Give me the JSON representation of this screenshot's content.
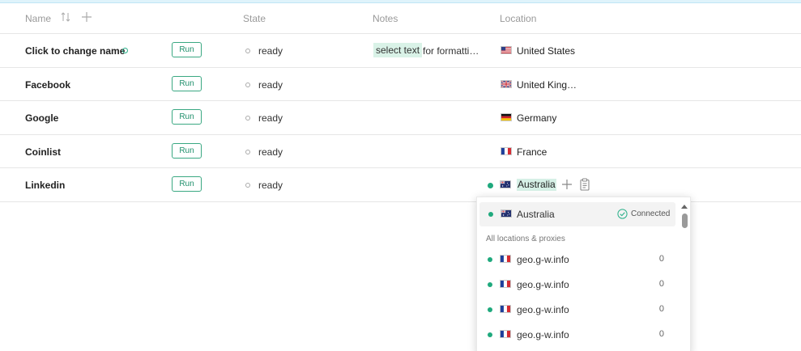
{
  "columns": {
    "name": "Name",
    "state": "State",
    "notes": "Notes",
    "location": "Location"
  },
  "run_label": "Run",
  "rows": [
    {
      "name": "Click to change name",
      "state": "ready",
      "note_highlight": "select text",
      "note_rest": "for formatti…",
      "location": "United States",
      "flag": "us"
    },
    {
      "name": "Facebook",
      "state": "ready",
      "note_highlight": "",
      "note_rest": "",
      "location": "United King…",
      "flag": "uk"
    },
    {
      "name": "Google",
      "state": "ready",
      "note_highlight": "",
      "note_rest": "",
      "location": "Germany",
      "flag": "de"
    },
    {
      "name": "Coinlist",
      "state": "ready",
      "note_highlight": "",
      "note_rest": "",
      "location": "France",
      "flag": "fr"
    },
    {
      "name": "Linkedin",
      "state": "ready",
      "note_highlight": "",
      "note_rest": "",
      "location": "Australia",
      "flag": "au"
    }
  ],
  "popup": {
    "selected": {
      "label": "Australia",
      "status": "Connected",
      "flag": "au"
    },
    "section_label": "All locations & proxies",
    "items": [
      {
        "label": "geo.g-w.info",
        "count": "0",
        "flag": "fr"
      },
      {
        "label": "geo.g-w.info",
        "count": "0",
        "flag": "fr"
      },
      {
        "label": "geo.g-w.info",
        "count": "0",
        "flag": "fr"
      },
      {
        "label": "geo.g-w.info",
        "count": "0",
        "flag": "fr"
      }
    ]
  },
  "colors": {
    "accent": "#1fa97d",
    "highlight": "#d9f2e7"
  },
  "icons": [
    "sort-icon",
    "add-column-icon",
    "plus-icon",
    "clipboard-icon",
    "check-circle-icon",
    "scroll-up-icon"
  ]
}
